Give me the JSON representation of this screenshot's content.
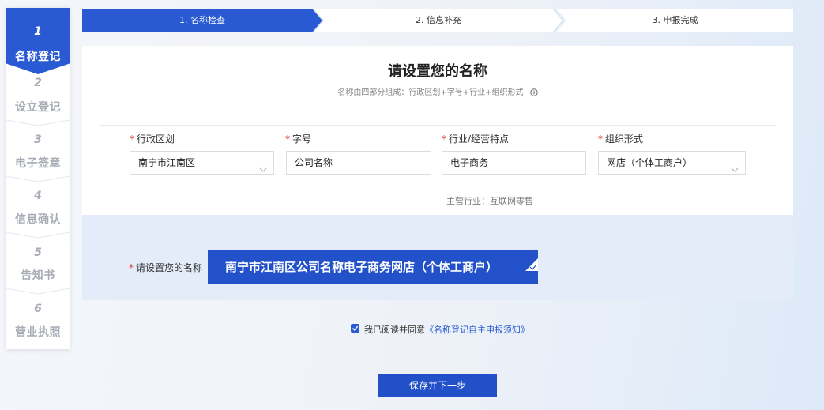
{
  "sidebar": {
    "steps": [
      {
        "num": "1",
        "label": "名称登记"
      },
      {
        "num": "2",
        "label": "设立登记"
      },
      {
        "num": "3",
        "label": "电子签章"
      },
      {
        "num": "4",
        "label": "信息确认"
      },
      {
        "num": "5",
        "label": "告知书"
      },
      {
        "num": "6",
        "label": "营业执照"
      }
    ],
    "active_index": 0
  },
  "progress": {
    "steps": [
      "1. 名称检查",
      "2. 信息补充",
      "3. 申报完成"
    ],
    "active_index": 0
  },
  "form": {
    "title": "请设置您的名称",
    "subtitle": "名称由四部分组成：行政区划+字号+行业+组织形式",
    "required_mark": "*",
    "fields": [
      {
        "label": "行政区划",
        "value": "南宁市江南区",
        "type": "select"
      },
      {
        "label": "字号",
        "value": "公司名称",
        "type": "input"
      },
      {
        "label": "行业/经营特点",
        "value": "电子商务",
        "type": "input"
      },
      {
        "label": "组织形式",
        "value": "网店（个体工商户）",
        "type": "select"
      }
    ],
    "industry_note": "主营行业：互联网零售"
  },
  "name_panel": {
    "label": "请设置您的名称",
    "full_name": "南宁市江南区公司名称电子商务网店（个体工商户）"
  },
  "agreement": {
    "checked": true,
    "text": "我已阅读并同意",
    "link": "《名称登记自主申报须知》"
  },
  "actions": {
    "save_next": "保存并下一步"
  },
  "colors": {
    "primary": "#2a5ad3",
    "panel_bg": "#e3ecf8",
    "required": "#e0352b"
  }
}
